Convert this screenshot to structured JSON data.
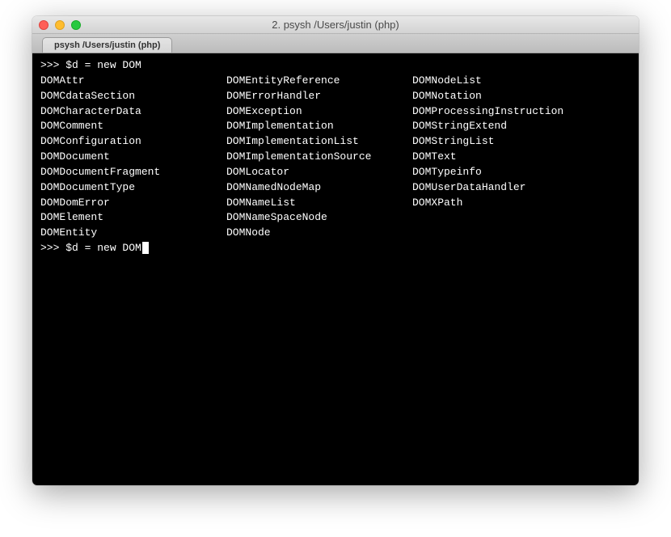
{
  "window": {
    "title": "2. psysh  /Users/justin (php)"
  },
  "tab": {
    "label": "psysh  /Users/justin (php)"
  },
  "terminal": {
    "prompt": ">>> ",
    "input_line_1": "$d = new DOM",
    "input_line_2": "$d = new DOM",
    "completions": {
      "col0": [
        "DOMAttr",
        "DOMCdataSection",
        "DOMCharacterData",
        "DOMComment",
        "DOMConfiguration",
        "DOMDocument",
        "DOMDocumentFragment",
        "DOMDocumentType",
        "DOMDomError",
        "DOMElement",
        "DOMEntity"
      ],
      "col1": [
        "DOMEntityReference",
        "DOMErrorHandler",
        "DOMException",
        "DOMImplementation",
        "DOMImplementationList",
        "DOMImplementationSource",
        "DOMLocator",
        "DOMNamedNodeMap",
        "DOMNameList",
        "DOMNameSpaceNode",
        "DOMNode"
      ],
      "col2": [
        "DOMNodeList",
        "DOMNotation",
        "DOMProcessingInstruction",
        "DOMStringExtend",
        "DOMStringList",
        "DOMText",
        "DOMTypeinfo",
        "DOMUserDataHandler",
        "DOMXPath"
      ]
    }
  }
}
